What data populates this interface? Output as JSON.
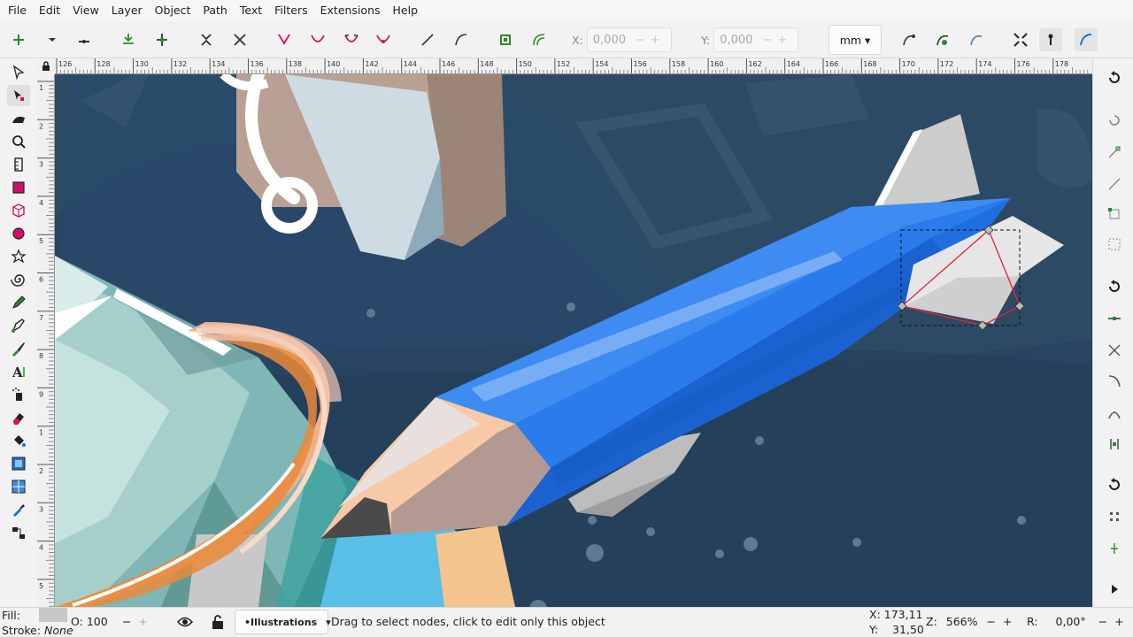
{
  "menu": [
    "File",
    "Edit",
    "View",
    "Layer",
    "Object",
    "Path",
    "Text",
    "Filters",
    "Extensions",
    "Help"
  ],
  "toolbar": {
    "x_label": "X:",
    "x_value": "0,000",
    "y_label": "Y:",
    "y_value": "0,000",
    "unit": "mm"
  },
  "ruler": {
    "top_ticks": [
      "126",
      "128",
      "130",
      "132",
      "134",
      "136",
      "138",
      "140",
      "142",
      "144",
      "146",
      "148",
      "150",
      "152",
      "154",
      "156",
      "158",
      "160",
      "162",
      "164",
      "166",
      "168",
      "170",
      "172",
      "174",
      "176",
      "178"
    ],
    "left_ticks": [
      "1",
      "2",
      "3",
      "4",
      "5",
      "6",
      "7",
      "8",
      "9",
      "1",
      "2",
      "3",
      "4",
      "5"
    ]
  },
  "status": {
    "fill_label": "Fill:",
    "stroke_label": "Stroke:",
    "stroke_value": "None",
    "opacity_label": "O:",
    "opacity_value": "100",
    "layer_name": "•Illustrations",
    "message": "Drag to select nodes, click to edit only this object",
    "x_label": "X:",
    "x_value": "173,11",
    "y_label": "Y:",
    "y_value": "31,50",
    "zoom_label": "Z:",
    "zoom_value": "566%",
    "rotation_label": "R:",
    "rotation_value": "0,00°"
  },
  "colors": {
    "accent": "#1a73c8",
    "node_select": "#e8203a",
    "canvas_bg": "#2c4a63"
  }
}
